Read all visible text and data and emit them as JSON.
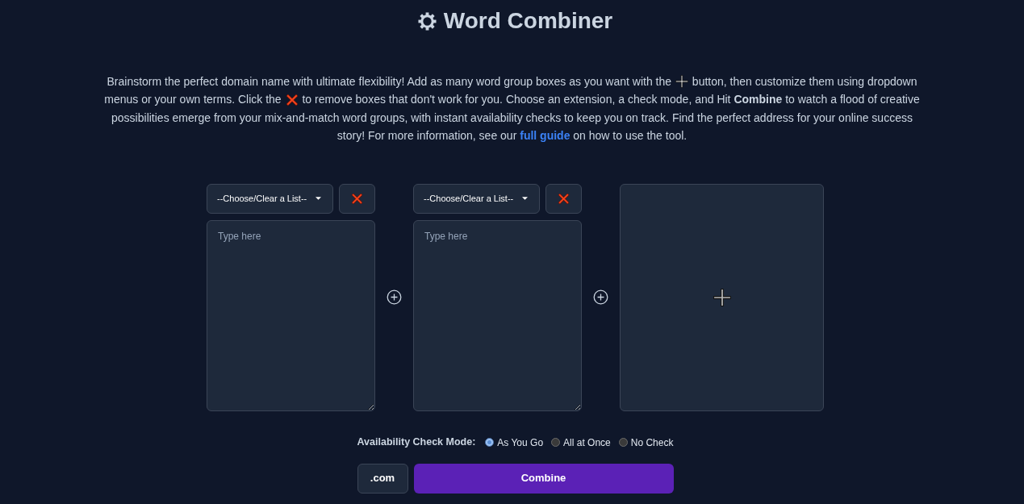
{
  "header": {
    "title": "Word Combiner"
  },
  "intro": {
    "parts": [
      {
        "kind": "text",
        "text": "Brainstorm the perfect domain name with ultimate flexibility! Add as many word group boxes as you want with the "
      },
      {
        "kind": "plus_icon"
      },
      {
        "kind": "text",
        "text": " button, then customize them using dropdown menus or your own terms. Click the "
      },
      {
        "kind": "cross_icon"
      },
      {
        "kind": "text",
        "text": " to remove boxes that don't work for you. Choose an extension, a check mode, and Hit **Combine** to watch a flood of creative possibilities emerge from your mix-and-match word groups, with instant availability checks to keep you on track. Find the perfect address for your online success story! For more information, see our "
      },
      {
        "kind": "link",
        "text": "full guide"
      },
      {
        "kind": "text",
        "text": " on how to use the tool."
      }
    ]
  },
  "word_groups": [
    {
      "list_select": "--Choose/Clear a List--",
      "placeholder": "Type here"
    },
    {
      "list_select": "--Choose/Clear a List--",
      "placeholder": "Type here"
    }
  ],
  "availability_check": {
    "label": "Availability Check Mode:",
    "options": [
      {
        "label": "As You Go",
        "selected": true
      },
      {
        "label": "All at Once",
        "selected": false
      },
      {
        "label": "No Check",
        "selected": false
      }
    ]
  },
  "extension": ".com",
  "combine_button": "Combine"
}
